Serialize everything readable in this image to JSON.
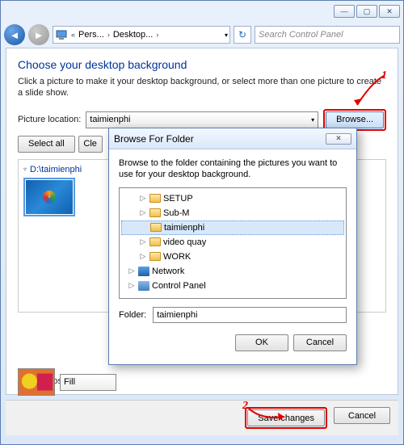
{
  "titlebar": {
    "min": "—",
    "max": "▢",
    "close": "✕"
  },
  "nav": {
    "back_glyph": "◄",
    "fwd_glyph": "►",
    "crumb1": "Pers...",
    "crumb2": "Desktop...",
    "sep": "›",
    "chev": "«",
    "refresh_glyph": "↻"
  },
  "search": {
    "placeholder": "Search Control Panel"
  },
  "page": {
    "heading": "Choose your desktop background",
    "subtext": "Click a picture to make it your desktop background, or select more than one picture to create a slide show.",
    "location_label": "Picture location:",
    "location_value": "taimienphi",
    "browse_label": "Browse...",
    "select_all": "Select all",
    "clear_all": "Cle",
    "group_header": "D:\\taimienphi",
    "position_label": "Picture position:",
    "position_value": "Fill",
    "tri": "▿",
    "check": "✓",
    "combo_arrow": "▾"
  },
  "bottom": {
    "save": "Save changes",
    "cancel": "Cancel"
  },
  "dialog": {
    "title": "Browse For Folder",
    "close": "✕",
    "desc": "Browse to the folder containing the pictures you want to use for your desktop background.",
    "tree": {
      "expander": "▷",
      "items": [
        "SETUP",
        "Sub-M",
        "taimienphi",
        "video quay",
        "WORK"
      ],
      "network": "Network",
      "control_panel": "Control Panel"
    },
    "folder_label": "Folder:",
    "folder_value": "taimienphi",
    "ok": "OK",
    "cancel": "Cancel"
  },
  "annotations": {
    "one": "1",
    "two": "2"
  }
}
